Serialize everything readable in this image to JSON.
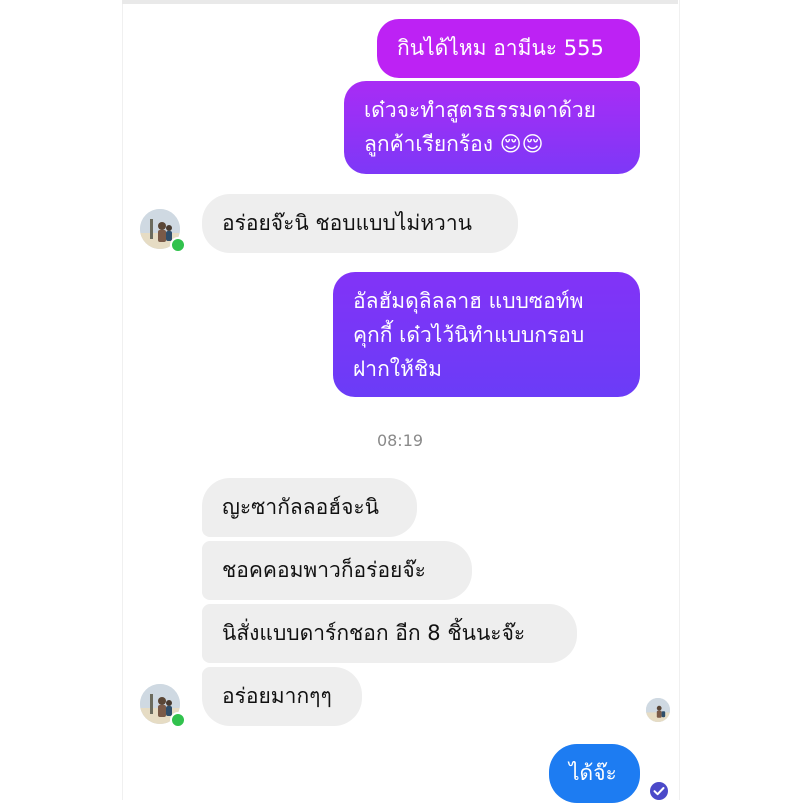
{
  "chat": {
    "messages": {
      "m1": "กินได้ไหม อามีนะ 555",
      "m2_l1": "เด๋วจะทำสูตรธรรมดาด้วย",
      "m2_l2": "ลูกค้าเรียกร้อง 😌😌",
      "m3": "อร่อยจ๊ะนิ ชอบแบบไม่หวาน",
      "m4_l1": "อัลฮัมดุลิลลาฮ  แบบซอท์พ",
      "m4_l2": "คุกกี้  เด๋วไว้นิทำแบบกรอบ",
      "m4_l3": "ฝากให้ชิม",
      "timestamp": "08:19",
      "m5": "ญะซากัลลอฮ์จะนิ",
      "m6": "ชอคคอมพาวก็อร่อยจ๊ะ",
      "m7": "นิสั่งแบบดาร์กชอก อีก 8 ชิ้นนะจ๊ะ",
      "m8": "อร่อยมากๆๆ",
      "m9": "ได้จ๊ะ"
    }
  },
  "colors": {
    "outgoing_gradient_top": "#c021f5",
    "outgoing_gradient_bottom": "#6a3cf7",
    "outgoing_blue": "#1d7cf2",
    "incoming_bg": "#eeeeee",
    "online_dot": "#31c24d"
  },
  "icons": {
    "avatar": "profile-photo",
    "online": "online-dot",
    "seen": "seen-avatar",
    "read": "read-check-icon"
  }
}
